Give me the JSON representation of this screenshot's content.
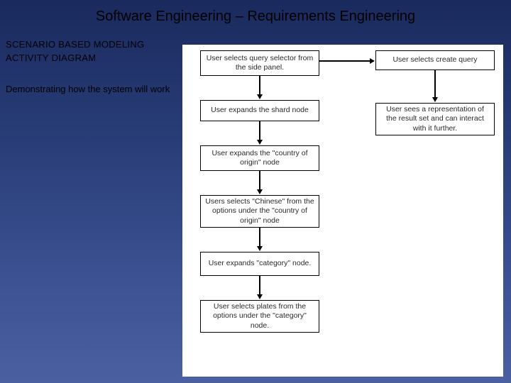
{
  "title": "Software Engineering – Requirements Engineering",
  "sidebar": {
    "heading1": "SCENARIO BASED MODELING",
    "heading2": "ACTIVITY DIAGRAM",
    "description": "Demonstrating how the system will work"
  },
  "diagram": {
    "node1": "User selects query selector from the side panel.",
    "node2": "User expands the shard node",
    "node3": "User expands the \"country of origin\" node",
    "node4": "Users selects \"Chinese\" from the options under the \"country of origin\" node",
    "node5": "User expands \"category\" node.",
    "node6": "User selects plates from the options under the \"category\" node.",
    "node7": "User selects create query",
    "node8": "User sees a representation of the result set and can interact with it further."
  }
}
